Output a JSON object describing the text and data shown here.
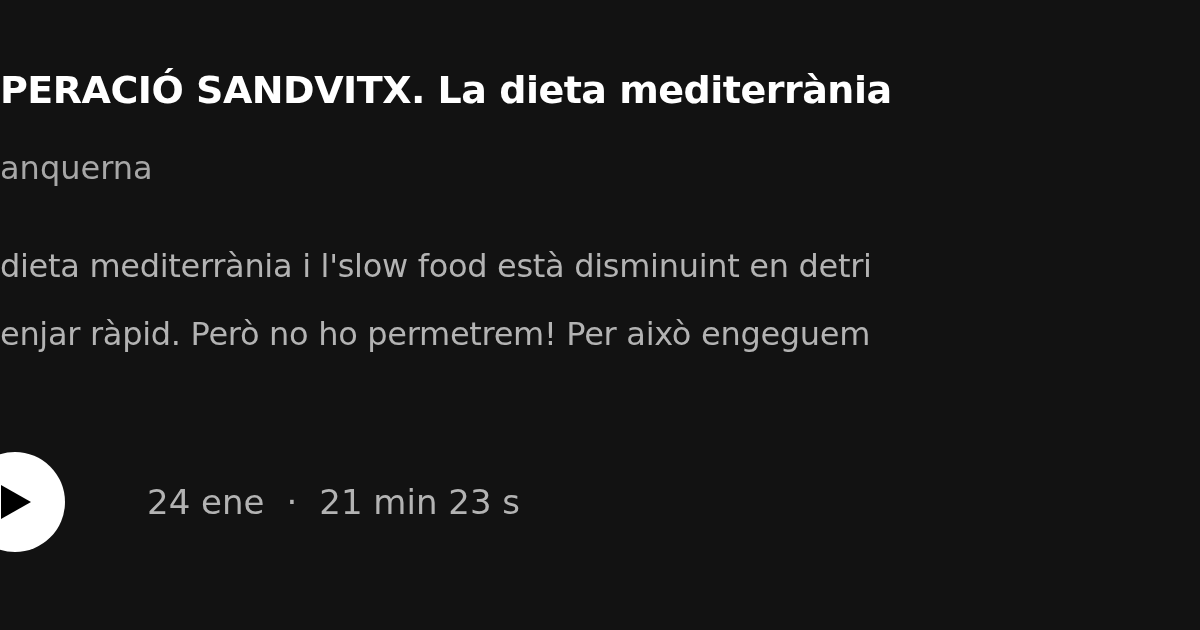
{
  "episode": {
    "title": "PERACIÓ SANDVITX. La dieta mediterrània",
    "show": "anquerna",
    "description_lines": [
      "dieta mediterrània i l'slow food està disminuint en detri",
      "enjar ràpid. Però no ho permetrem! Per això engeguem"
    ],
    "date": "24 ene",
    "separator": "·",
    "duration": "21 min 23 s"
  }
}
